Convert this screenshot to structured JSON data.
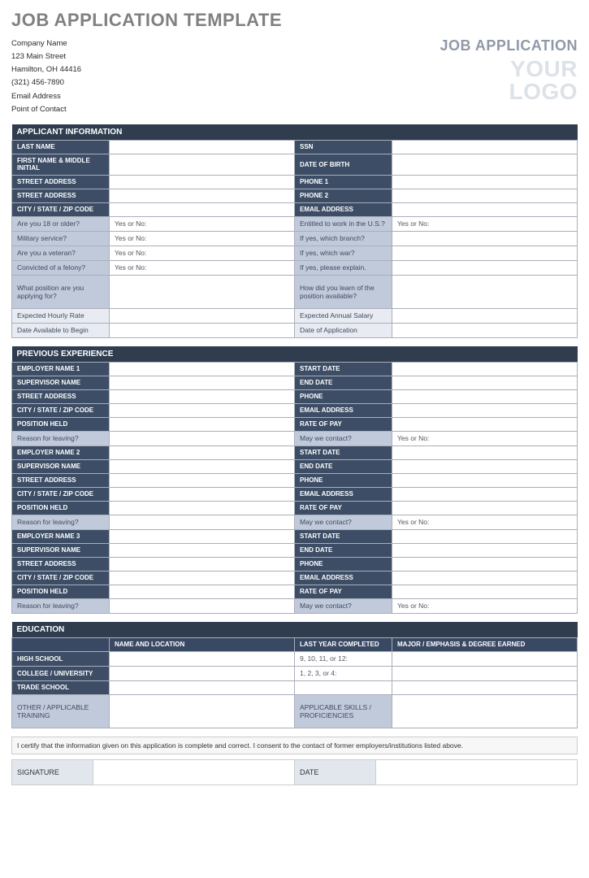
{
  "title": "JOB APPLICATION TEMPLATE",
  "company": {
    "name": "Company Name",
    "street": "123 Main Street",
    "city": "Hamilton, OH 44416",
    "phone": "(321) 456-7890",
    "email": "Email Address",
    "contact": "Point of Contact"
  },
  "header": {
    "label": "JOB APPLICATION",
    "logo1": "YOUR",
    "logo2": "LOGO"
  },
  "section1": {
    "title": "APPLICANT INFORMATION",
    "row1": {
      "l": "LAST NAME",
      "r": "SSN"
    },
    "row2": {
      "l": "FIRST NAME & MIDDLE INITIAL",
      "r": "DATE OF BIRTH"
    },
    "row3": {
      "l": "STREET ADDRESS",
      "r": "PHONE 1"
    },
    "row4": {
      "l": "STREET ADDRESS",
      "r": "PHONE 2"
    },
    "row5": {
      "l": "CITY / STATE / ZIP CODE",
      "r": "EMAIL ADDRESS"
    },
    "q1": {
      "l": "Are you 18 or older?",
      "lv": "Yes or No:",
      "r": "Entitled to work in the U.S.?",
      "rv": "Yes or No:"
    },
    "q2": {
      "l": "Military service?",
      "lv": "Yes or No:",
      "r": "If yes, which branch?",
      "rv": ""
    },
    "q3": {
      "l": "Are you a veteran?",
      "lv": "Yes or No:",
      "r": "If yes, which war?",
      "rv": ""
    },
    "q4": {
      "l": "Convicted of a felony?",
      "lv": "Yes or No:",
      "r": "If yes, please explain.",
      "rv": ""
    },
    "q5": {
      "l": "What position are you applying for?",
      "lv": "",
      "r": "How did you learn of the position available?",
      "rv": ""
    },
    "e1": {
      "l": "Expected Hourly Rate",
      "r": "Expected Annual Salary"
    },
    "e2": {
      "l": "Date Available to Begin",
      "r": "Date of Application"
    }
  },
  "section2": {
    "title": "PREVIOUS EXPERIENCE",
    "emp": [
      {
        "n": "EMPLOYER NAME 1"
      },
      {
        "n": "EMPLOYER NAME 2"
      },
      {
        "n": "EMPLOYER NAME 3"
      }
    ],
    "labels": {
      "start": "START DATE",
      "super": "SUPERVISOR NAME",
      "end": "END DATE",
      "street": "STREET ADDRESS",
      "phone": "PHONE",
      "csz": "CITY / STATE / ZIP CODE",
      "email": "EMAIL ADDRESS",
      "pos": "POSITION HELD",
      "rate": "RATE OF PAY",
      "reason": "Reason for leaving?",
      "contact": "May we contact?",
      "yn": "Yes or No:"
    }
  },
  "section3": {
    "title": "EDUCATION",
    "h1": "NAME AND LOCATION",
    "h2": "LAST YEAR COMPLETED",
    "h3": "MAJOR / EMPHASIS & DEGREE EARNED",
    "r1": {
      "l": "HIGH SCHOOL",
      "v": "9, 10, 11, or 12:"
    },
    "r2": {
      "l": "COLLEGE / UNIVERSITY",
      "v": "1, 2, 3, or 4:"
    },
    "r3": {
      "l": "TRADE SCHOOL",
      "v": ""
    },
    "r4": {
      "l": "OTHER / APPLICABLE TRAINING",
      "r": "APPLICABLE SKILLS / PROFICIENCIES"
    }
  },
  "cert": "I certify that the information given on this application is complete and correct. I consent to the contact of former employers/institutions listed above.",
  "sig": {
    "l": "SIGNATURE",
    "r": "DATE"
  }
}
